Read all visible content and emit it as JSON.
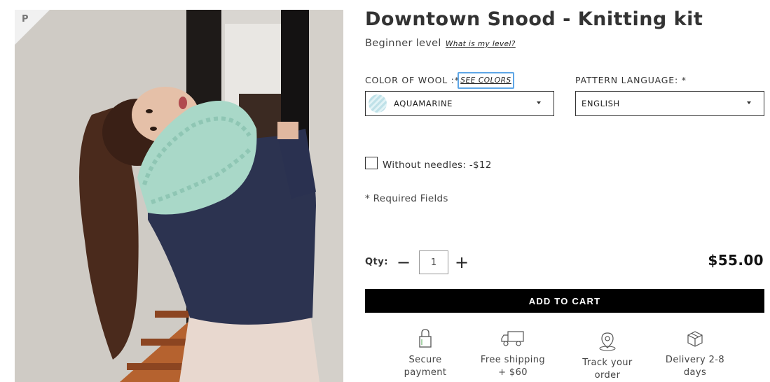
{
  "product": {
    "title": "Downtown Snood - Knitting kit",
    "level": "Beginner level",
    "level_link": "What is my level?",
    "pin_icon": "P"
  },
  "options": {
    "color_label": "COLOR OF WOOL :*",
    "see_colors": "SEE COLORS",
    "color_value": "AQUAMARINE",
    "pattern_label": "PATTERN LANGUAGE: *",
    "pattern_value": "ENGLISH"
  },
  "extras": {
    "needles_label": "Without needles: -$12",
    "required_note": "* Required Fields"
  },
  "purchase": {
    "qty_label": "Qty:",
    "minus": "−",
    "plus": "+",
    "qty": "1",
    "price": "$55.00",
    "add_to_cart": "ADD TO CART"
  },
  "features": [
    {
      "icon": "lock-icon",
      "line1": "Secure",
      "line2": "payment"
    },
    {
      "icon": "truck-icon",
      "line1": "Free shipping",
      "line2": "+ $60"
    },
    {
      "icon": "map-pin-icon",
      "line1": "Track your",
      "line2": "order"
    },
    {
      "icon": "box-icon",
      "line1": "Delivery 2-8",
      "line2": "days"
    }
  ],
  "colors": {
    "accent_focus": "#5ea6e6",
    "button_bg": "#000000",
    "scarf": "#a9d8c8"
  }
}
